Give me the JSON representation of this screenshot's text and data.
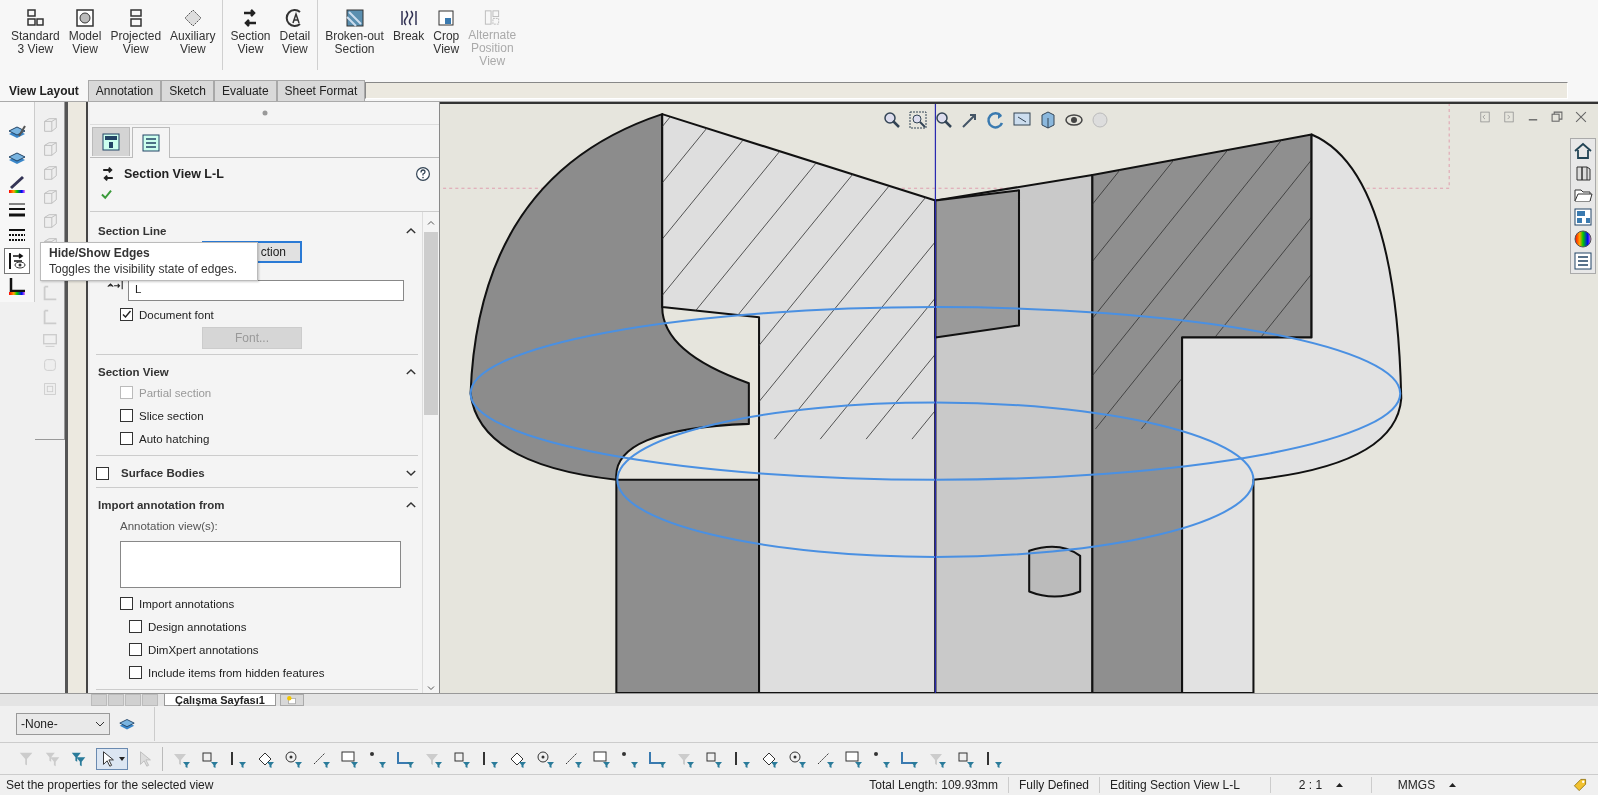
{
  "ribbon": {
    "groups": [
      [
        {
          "label": "Standard\n3 View",
          "disabled": false
        },
        {
          "label": "Model\nView",
          "disabled": false
        },
        {
          "label": "Projected\nView",
          "disabled": false
        },
        {
          "label": "Auxiliary\nView",
          "disabled": false
        }
      ],
      [
        {
          "label": "Section\nView",
          "disabled": false
        },
        {
          "label": "Detail\nView",
          "disabled": false
        }
      ],
      [
        {
          "label": "Broken-out\nSection",
          "disabled": false
        },
        {
          "label": "Break",
          "disabled": false
        },
        {
          "label": "Crop\nView",
          "disabled": false
        },
        {
          "label": "Alternate\nPosition\nView",
          "disabled": true
        }
      ]
    ]
  },
  "command_tabs": [
    {
      "label": "View Layout",
      "selected": true
    },
    {
      "label": "Annotation",
      "selected": false
    },
    {
      "label": "Sketch",
      "selected": false
    },
    {
      "label": "Evaluate",
      "selected": false
    },
    {
      "label": "Sheet Format",
      "selected": false
    }
  ],
  "tooltip": {
    "title": "Hide/Show Edges",
    "text": "Toggles the visibility state of edges."
  },
  "property_manager": {
    "tabs": [
      {
        "selected": false
      },
      {
        "selected": true
      }
    ],
    "title": "Section View L-L",
    "sections": [
      {
        "title": "Section Line",
        "expanded": true,
        "items": [
          {
            "kind": "button",
            "label": "ction",
            "disabled": false
          },
          {
            "kind": "text_field",
            "value": "L"
          },
          {
            "kind": "checkbox",
            "label": "Document font",
            "checked": true,
            "disabled": false
          },
          {
            "kind": "button",
            "label": "Font...",
            "disabled": true
          }
        ]
      },
      {
        "title": "Section View",
        "expanded": true,
        "items": [
          {
            "kind": "checkbox",
            "label": "Partial section",
            "checked": false,
            "disabled": true
          },
          {
            "kind": "checkbox",
            "label": "Slice section",
            "checked": false,
            "disabled": false
          },
          {
            "kind": "checkbox",
            "label": "Auto hatching",
            "checked": false,
            "disabled": false
          }
        ]
      },
      {
        "title": "Surface Bodies",
        "expanded": false,
        "checked": false
      },
      {
        "title": "Import annotation from",
        "expanded": true,
        "items": [
          {
            "kind": "caption",
            "text": "Annotation view(s):"
          },
          {
            "kind": "list_box"
          },
          {
            "kind": "checkbox",
            "label": "Import annotations",
            "checked": false,
            "disabled": false,
            "children": [
              {
                "kind": "checkbox",
                "label": "Design annotations",
                "checked": false,
                "disabled": false
              },
              {
                "kind": "checkbox",
                "label": "DimXpert annotations",
                "checked": false,
                "disabled": false
              },
              {
                "kind": "checkbox",
                "label": "Include items from hidden features",
                "checked": false,
                "disabled": false
              }
            ]
          }
        ]
      }
    ]
  },
  "sheet_tabs": [
    {
      "label": "Çalışma Sayfası1",
      "selected": true
    }
  ],
  "layer": {
    "value": "-None-"
  },
  "status_bar": {
    "message": "Set the properties for the selected view",
    "fields": [
      {
        "text": "Total Length: 109.93mm",
        "has_menu": false
      },
      {
        "text": "Fully Defined",
        "has_menu": false
      },
      {
        "text": "Editing Section View L-L",
        "has_menu": false
      },
      {
        "text": "2 : 1",
        "has_menu": true
      },
      {
        "text": "MMGS",
        "has_menu": true
      }
    ]
  }
}
